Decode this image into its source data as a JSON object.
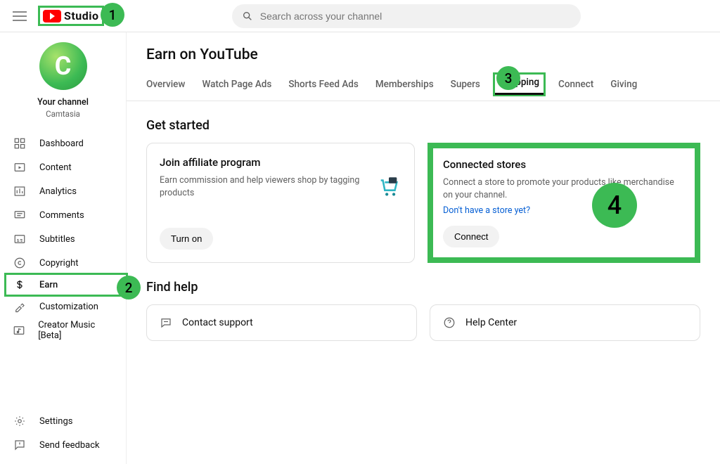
{
  "header": {
    "logo_text": "Studio",
    "search_placeholder": "Search across your channel"
  },
  "profile": {
    "avatar_letter": "C",
    "title": "Your channel",
    "subtitle": "Camtasia"
  },
  "sidebar": {
    "items": [
      {
        "icon": "dashboard",
        "label": "Dashboard"
      },
      {
        "icon": "content",
        "label": "Content"
      },
      {
        "icon": "analytics",
        "label": "Analytics"
      },
      {
        "icon": "comments",
        "label": "Comments"
      },
      {
        "icon": "subtitles",
        "label": "Subtitles"
      },
      {
        "icon": "copyright",
        "label": "Copyright"
      },
      {
        "icon": "earn",
        "label": "Earn"
      },
      {
        "icon": "customization",
        "label": "Customization"
      },
      {
        "icon": "music",
        "label": "Creator Music [Beta]"
      }
    ],
    "bottom": [
      {
        "icon": "settings",
        "label": "Settings"
      },
      {
        "icon": "feedback",
        "label": "Send feedback"
      }
    ]
  },
  "page": {
    "title": "Earn on YouTube",
    "tabs": [
      "Overview",
      "Watch Page Ads",
      "Shorts Feed Ads",
      "Memberships",
      "Supers",
      "Shopping",
      "Connect",
      "Giving"
    ],
    "active_tab_index": 5
  },
  "sections": {
    "get_started": {
      "title": "Get started",
      "affiliate": {
        "title": "Join affiliate program",
        "desc": "Earn commission and help viewers shop by tagging products",
        "button": "Turn on"
      },
      "connected": {
        "title": "Connected stores",
        "desc": "Connect a store to promote your products like merchandise on your channel.",
        "link": "Don't have a store yet?",
        "button": "Connect"
      }
    },
    "find_help": {
      "title": "Find help",
      "contact": "Contact support",
      "help_center": "Help Center"
    }
  },
  "markers": {
    "m1": "1",
    "m2": "2",
    "m3": "3",
    "m4": "4"
  }
}
